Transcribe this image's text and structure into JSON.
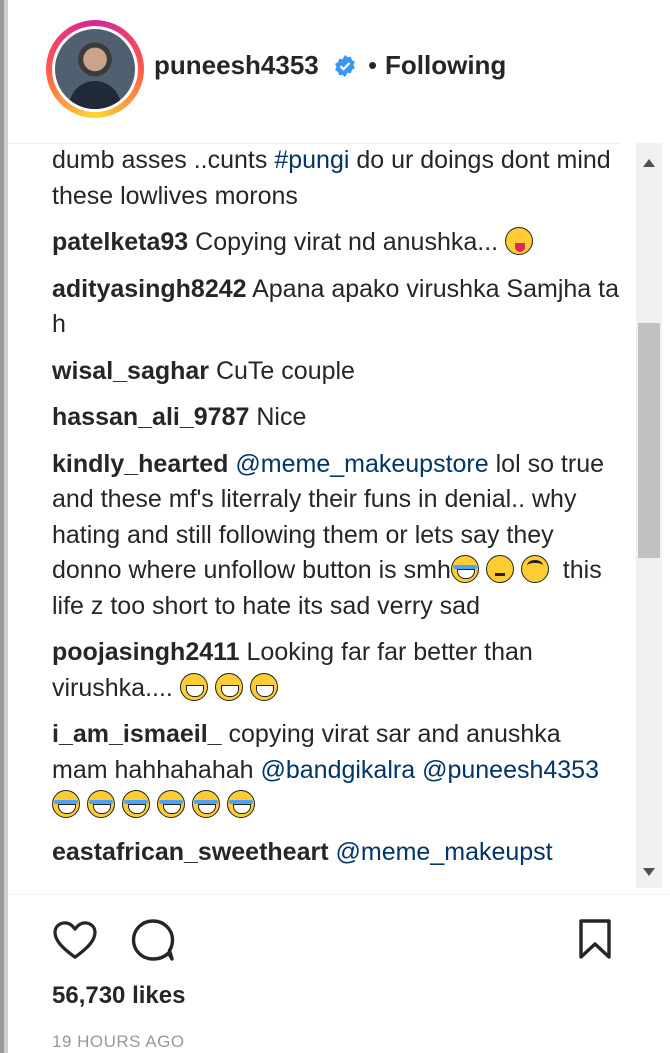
{
  "header": {
    "username": "puneesh4353",
    "separator": "•",
    "follow_status": "Following",
    "verified": true
  },
  "comments": [
    {
      "user": "",
      "parts": [
        {
          "t": "text",
          "v": "dumb asses ..cunts "
        },
        {
          "t": "link",
          "v": "#pungi"
        },
        {
          "t": "text",
          "v": " do ur doings dont mind these lowlives morons"
        }
      ]
    },
    {
      "user": "patelketa93",
      "parts": [
        {
          "t": "text",
          "v": " Copying virat nd anushka... "
        },
        {
          "t": "emoji",
          "v": "tongue"
        }
      ]
    },
    {
      "user": "adityasingh8242",
      "parts": [
        {
          "t": "text",
          "v": " Apana apako virushka Samjha ta h"
        }
      ]
    },
    {
      "user": "wisal_saghar",
      "parts": [
        {
          "t": "text",
          "v": " CuTe couple"
        }
      ]
    },
    {
      "user": "hassan_ali_9787",
      "parts": [
        {
          "t": "text",
          "v": " Nice"
        }
      ]
    },
    {
      "user": "kindly_hearted",
      "parts": [
        {
          "t": "text",
          "v": " "
        },
        {
          "t": "link",
          "v": "@meme_makeupstore"
        },
        {
          "t": "text",
          "v": " lol so true and these mf's literraly their funs in denial.. why hating and still following them or lets say they donno where unfollow button is smh"
        },
        {
          "t": "emoji",
          "v": "laugh"
        },
        {
          "t": "emoji",
          "v": "think"
        },
        {
          "t": "emoji",
          "v": "roll"
        },
        {
          "t": "text",
          "v": " this life z too short to hate its sad verry sad"
        }
      ]
    },
    {
      "user": "poojasingh2411",
      "parts": [
        {
          "t": "text",
          "v": " Looking far far better than virushka.... "
        },
        {
          "t": "emoji",
          "v": "grin"
        },
        {
          "t": "emoji",
          "v": "grin"
        },
        {
          "t": "emoji",
          "v": "grin"
        }
      ]
    },
    {
      "user": "i_am_ismaeil_",
      "parts": [
        {
          "t": "text",
          "v": " copying virat sar and anushka mam hahhahahah "
        },
        {
          "t": "link",
          "v": "@bandgikalra"
        },
        {
          "t": "text",
          "v": " "
        },
        {
          "t": "link",
          "v": "@puneesh4353"
        },
        {
          "t": "text",
          "v": " "
        },
        {
          "t": "emoji",
          "v": "laugh"
        },
        {
          "t": "emoji",
          "v": "laugh"
        },
        {
          "t": "emoji",
          "v": "laugh"
        },
        {
          "t": "emoji",
          "v": "laugh"
        },
        {
          "t": "emoji",
          "v": "laugh"
        },
        {
          "t": "emoji",
          "v": "laugh"
        }
      ]
    },
    {
      "user": "eastafrican_sweetheart",
      "parts": [
        {
          "t": "text",
          "v": " "
        },
        {
          "t": "link",
          "v": "@meme_makeupst"
        }
      ]
    }
  ],
  "actions": {
    "like_icon": "heart-outline",
    "comment_icon": "speech-bubble",
    "save_icon": "bookmark-outline"
  },
  "likes": "56,730 likes",
  "timestamp": "19 HOURS AGO",
  "colors": {
    "text": "#262626",
    "link": "#003569",
    "muted": "#999999",
    "verified": "#3897f0"
  }
}
